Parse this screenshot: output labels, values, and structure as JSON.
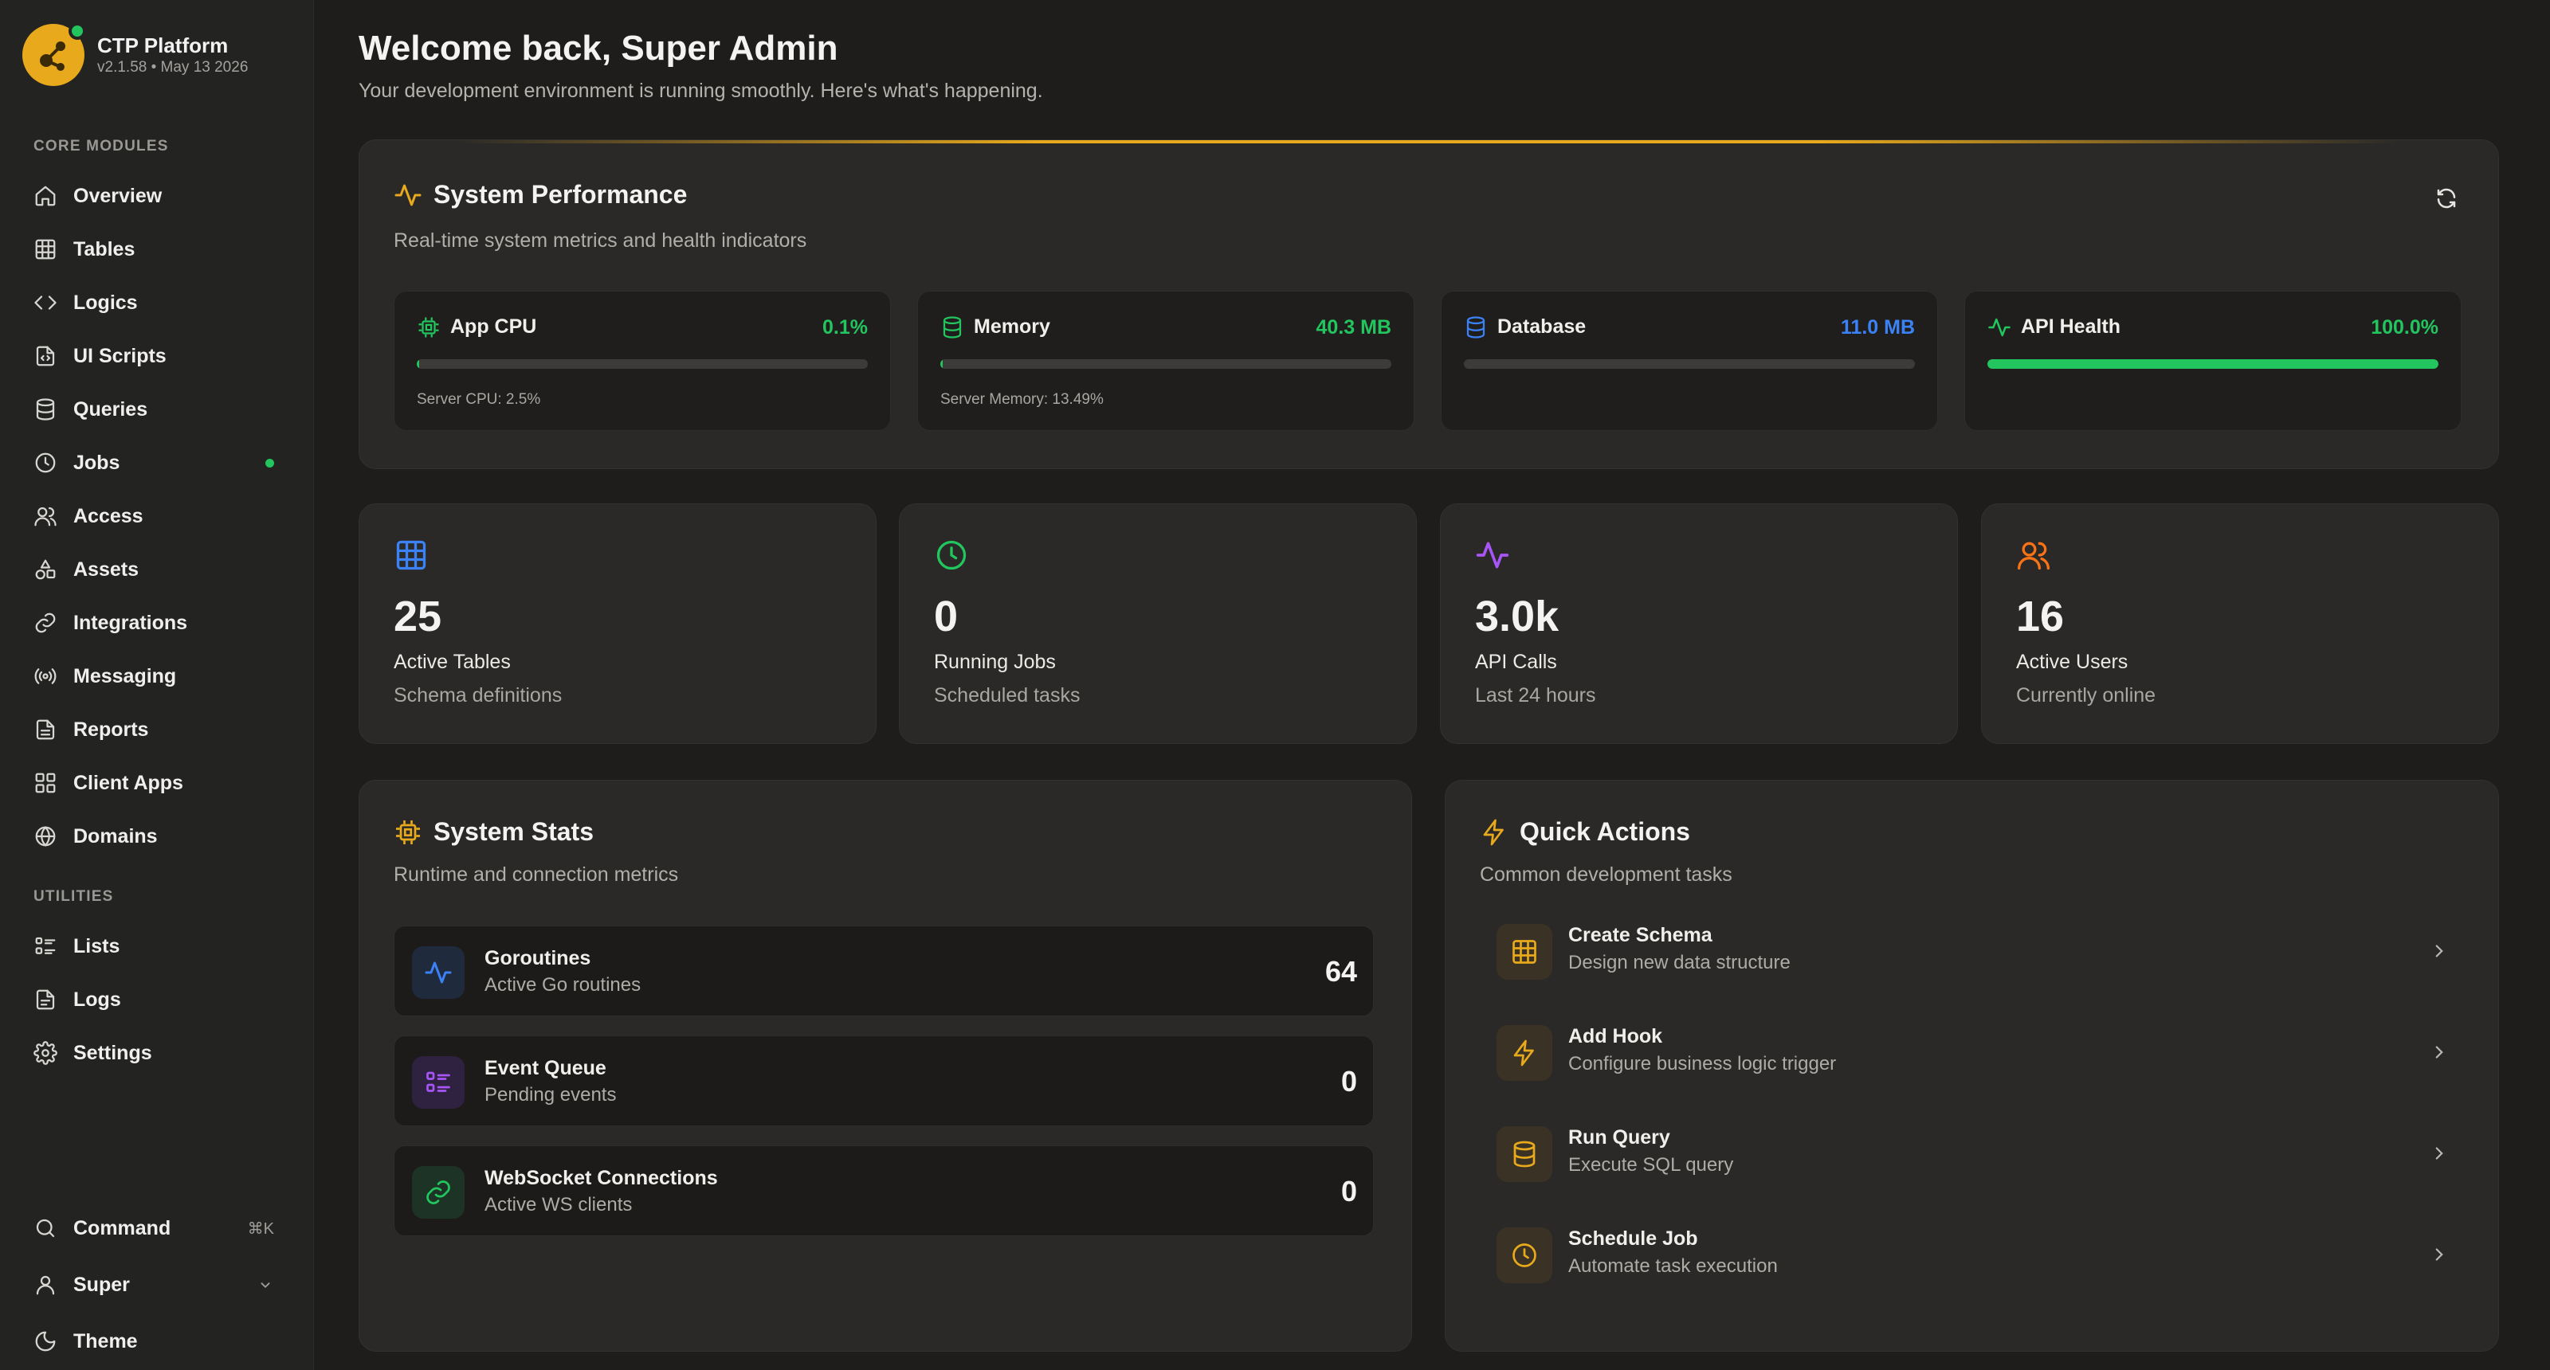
{
  "brand": {
    "name": "CTP Platform",
    "version": "v2.1.58 • May 13 2026"
  },
  "sidebar": {
    "core_title": "CORE MODULES",
    "core": [
      {
        "label": "Overview",
        "icon": "home-icon"
      },
      {
        "label": "Tables",
        "icon": "table-icon"
      },
      {
        "label": "Logics",
        "icon": "code-icon"
      },
      {
        "label": "UI Scripts",
        "icon": "file-code-icon"
      },
      {
        "label": "Queries",
        "icon": "database-icon"
      },
      {
        "label": "Jobs",
        "icon": "clock-icon"
      },
      {
        "label": "Access",
        "icon": "users-icon"
      },
      {
        "label": "Assets",
        "icon": "shapes-icon"
      },
      {
        "label": "Integrations",
        "icon": "link-icon"
      },
      {
        "label": "Messaging",
        "icon": "radio-icon"
      },
      {
        "label": "Reports",
        "icon": "report-icon"
      },
      {
        "label": "Client Apps",
        "icon": "grid-icon"
      },
      {
        "label": "Domains",
        "icon": "globe-icon"
      }
    ],
    "utilities_title": "UTILITIES",
    "utilities": [
      {
        "label": "Lists",
        "icon": "list-icon"
      },
      {
        "label": "Logs",
        "icon": "log-icon"
      },
      {
        "label": "Settings",
        "icon": "gear-icon"
      }
    ],
    "bottom": {
      "command_label": "Command",
      "command_shortcut": "⌘K",
      "user_label": "Super",
      "theme_label": "Theme"
    }
  },
  "header": {
    "title": "Welcome back, Super Admin",
    "subtitle": "Your development environment is running smoothly. Here's what's happening."
  },
  "performance": {
    "title": "System Performance",
    "subtitle": "Real-time system metrics and health indicators",
    "metrics": [
      {
        "name": "App CPU",
        "value": "0.1%",
        "fill": 0.001,
        "color": "#22c55e",
        "footer": "Server CPU: 2.5%"
      },
      {
        "name": "Memory",
        "value": "40.3 MB",
        "fill": 0.003,
        "color": "#22c55e",
        "footer": "Server Memory: 13.49%"
      },
      {
        "name": "Database",
        "value": "11.0 MB",
        "fill": 0,
        "color": "#3b82f6",
        "footer": ""
      },
      {
        "name": "API Health",
        "value": "100.0%",
        "fill": 1.0,
        "color": "#22c55e",
        "footer": ""
      }
    ]
  },
  "stats": [
    {
      "value": "25",
      "label": "Active Tables",
      "sub": "Schema definitions",
      "icon": "table-icon",
      "color": "#3b82f6"
    },
    {
      "value": "0",
      "label": "Running Jobs",
      "sub": "Scheduled tasks",
      "icon": "clock-icon",
      "color": "#22c55e"
    },
    {
      "value": "3.0k",
      "label": "API Calls",
      "sub": "Last 24 hours",
      "icon": "activity-icon",
      "color": "#a855f7"
    },
    {
      "value": "16",
      "label": "Active Users",
      "sub": "Currently online",
      "icon": "users-icon",
      "color": "#f97316"
    }
  ],
  "system_stats": {
    "title": "System Stats",
    "subtitle": "Runtime and connection metrics",
    "rows": [
      {
        "name": "Goroutines",
        "sub": "Active Go routines",
        "value": "64"
      },
      {
        "name": "Event Queue",
        "sub": "Pending events",
        "value": "0"
      },
      {
        "name": "WebSocket Connections",
        "sub": "Active WS clients",
        "value": "0"
      }
    ]
  },
  "quick_actions": {
    "title": "Quick Actions",
    "subtitle": "Common development tasks",
    "items": [
      {
        "name": "Create Schema",
        "sub": "Design new data structure"
      },
      {
        "name": "Add Hook",
        "sub": "Configure business logic trigger"
      },
      {
        "name": "Run Query",
        "sub": "Execute SQL query"
      },
      {
        "name": "Schedule Job",
        "sub": "Automate task execution"
      }
    ]
  }
}
